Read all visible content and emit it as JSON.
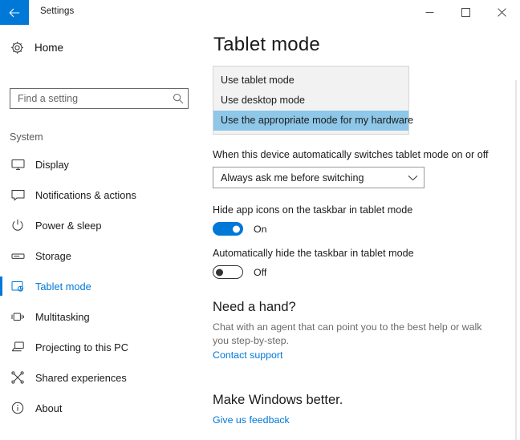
{
  "window": {
    "title": "Settings",
    "back_icon": "arrow-left-icon",
    "controls": [
      {
        "name": "minimize",
        "icon": "minimize-icon"
      },
      {
        "name": "maximize",
        "icon": "maximize-icon"
      },
      {
        "name": "close",
        "icon": "close-icon"
      }
    ]
  },
  "sidebar": {
    "home": {
      "label": "Home",
      "icon": "gear-icon"
    },
    "search": {
      "placeholder": "Find a setting",
      "value": "",
      "icon": "search-icon"
    },
    "group_header": "System",
    "items": [
      {
        "label": "Display",
        "icon": "monitor-icon",
        "selected": false
      },
      {
        "label": "Notifications & actions",
        "icon": "notification-icon",
        "selected": false
      },
      {
        "label": "Power & sleep",
        "icon": "power-icon",
        "selected": false
      },
      {
        "label": "Storage",
        "icon": "storage-icon",
        "selected": false
      },
      {
        "label": "Tablet mode",
        "icon": "tablet-icon",
        "selected": true
      },
      {
        "label": "Multitasking",
        "icon": "multitasking-icon",
        "selected": false
      },
      {
        "label": "Projecting to this PC",
        "icon": "projecting-icon",
        "selected": false
      },
      {
        "label": "Shared experiences",
        "icon": "shared-icon",
        "selected": false
      },
      {
        "label": "About",
        "icon": "info-icon",
        "selected": false
      }
    ]
  },
  "main": {
    "page_title": "Tablet mode",
    "mode_list": {
      "options": [
        {
          "label": "Use tablet mode",
          "highlighted": false
        },
        {
          "label": "Use desktop mode",
          "highlighted": false
        },
        {
          "label": "Use the appropriate mode for my hardware",
          "highlighted": true
        }
      ]
    },
    "switch_setting": {
      "label": "When this device automatically switches tablet mode on or off",
      "value": "Always ask me before switching",
      "arrow_icon": "chevron-down-icon"
    },
    "toggles": [
      {
        "label": "Hide app icons on the taskbar in tablet mode",
        "state": "On",
        "on": true
      },
      {
        "label": "Automatically hide the taskbar in tablet mode",
        "state": "Off",
        "on": false
      }
    ],
    "help_section": {
      "title": "Need a hand?",
      "body": "Chat with an agent that can point you to the best help or walk you step-by-step.",
      "link": "Contact support"
    },
    "feedback_section": {
      "title": "Make Windows better.",
      "link": "Give us feedback"
    }
  },
  "colors": {
    "accent": "#0078d7",
    "highlight": "#8ec7e8",
    "listbox_bg": "#f2f2f2",
    "muted_text": "#6b6b6b"
  }
}
